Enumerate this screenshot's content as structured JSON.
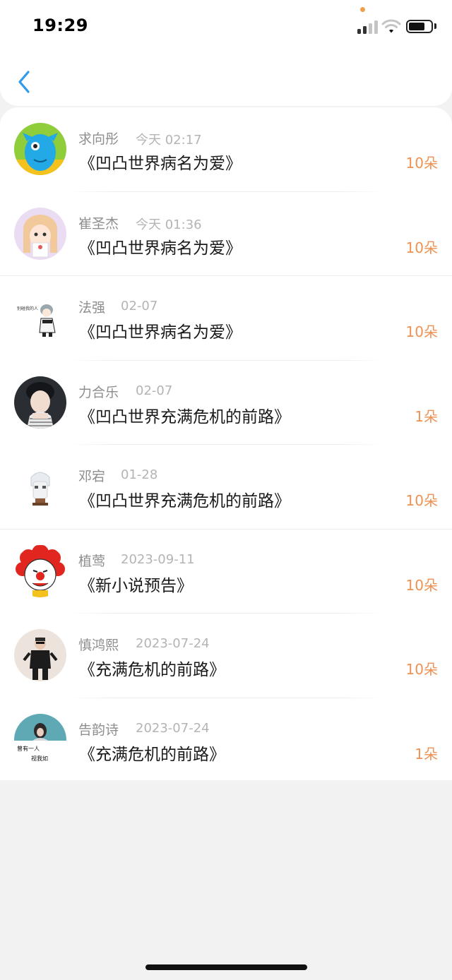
{
  "status_bar": {
    "time": "19:29",
    "accent_dot_color": "#f1a04a"
  },
  "nav": {
    "back_icon": "chevron-left-icon",
    "back_color": "#2f9bea"
  },
  "gifts": [
    {
      "name": "求向彤",
      "time": "今天 02:17",
      "title": "《凹凸世界病名为爱》",
      "amount": "10朵"
    },
    {
      "name": "崔圣杰",
      "time": "今天 01:36",
      "title": "《凹凸世界病名为爱》",
      "amount": "10朵"
    },
    {
      "name": "法强",
      "time": "02-07",
      "title": "《凹凸世界病名为爱》",
      "amount": "10朵"
    },
    {
      "name": "力合乐",
      "time": "02-07",
      "title": "《凹凸世界充满危机的前路》",
      "amount": "1朵"
    },
    {
      "name": "邓宕",
      "time": "01-28",
      "title": "《凹凸世界充满危机的前路》",
      "amount": "10朵"
    },
    {
      "name": "植莺",
      "time": "2023-09-11",
      "title": "《新小说预告》",
      "amount": "10朵"
    },
    {
      "name": "慎鸿熙",
      "time": "2023-07-24",
      "title": "《充满危机的前路》",
      "amount": "10朵"
    },
    {
      "name": "告韵诗",
      "time": "2023-07-24",
      "title": "《充满危机的前路》",
      "amount": "1朵"
    }
  ],
  "colors": {
    "amount": "#ee9152",
    "name": "#8e8e8e",
    "time": "#b4b4b4",
    "title": "#1a1a1a"
  }
}
